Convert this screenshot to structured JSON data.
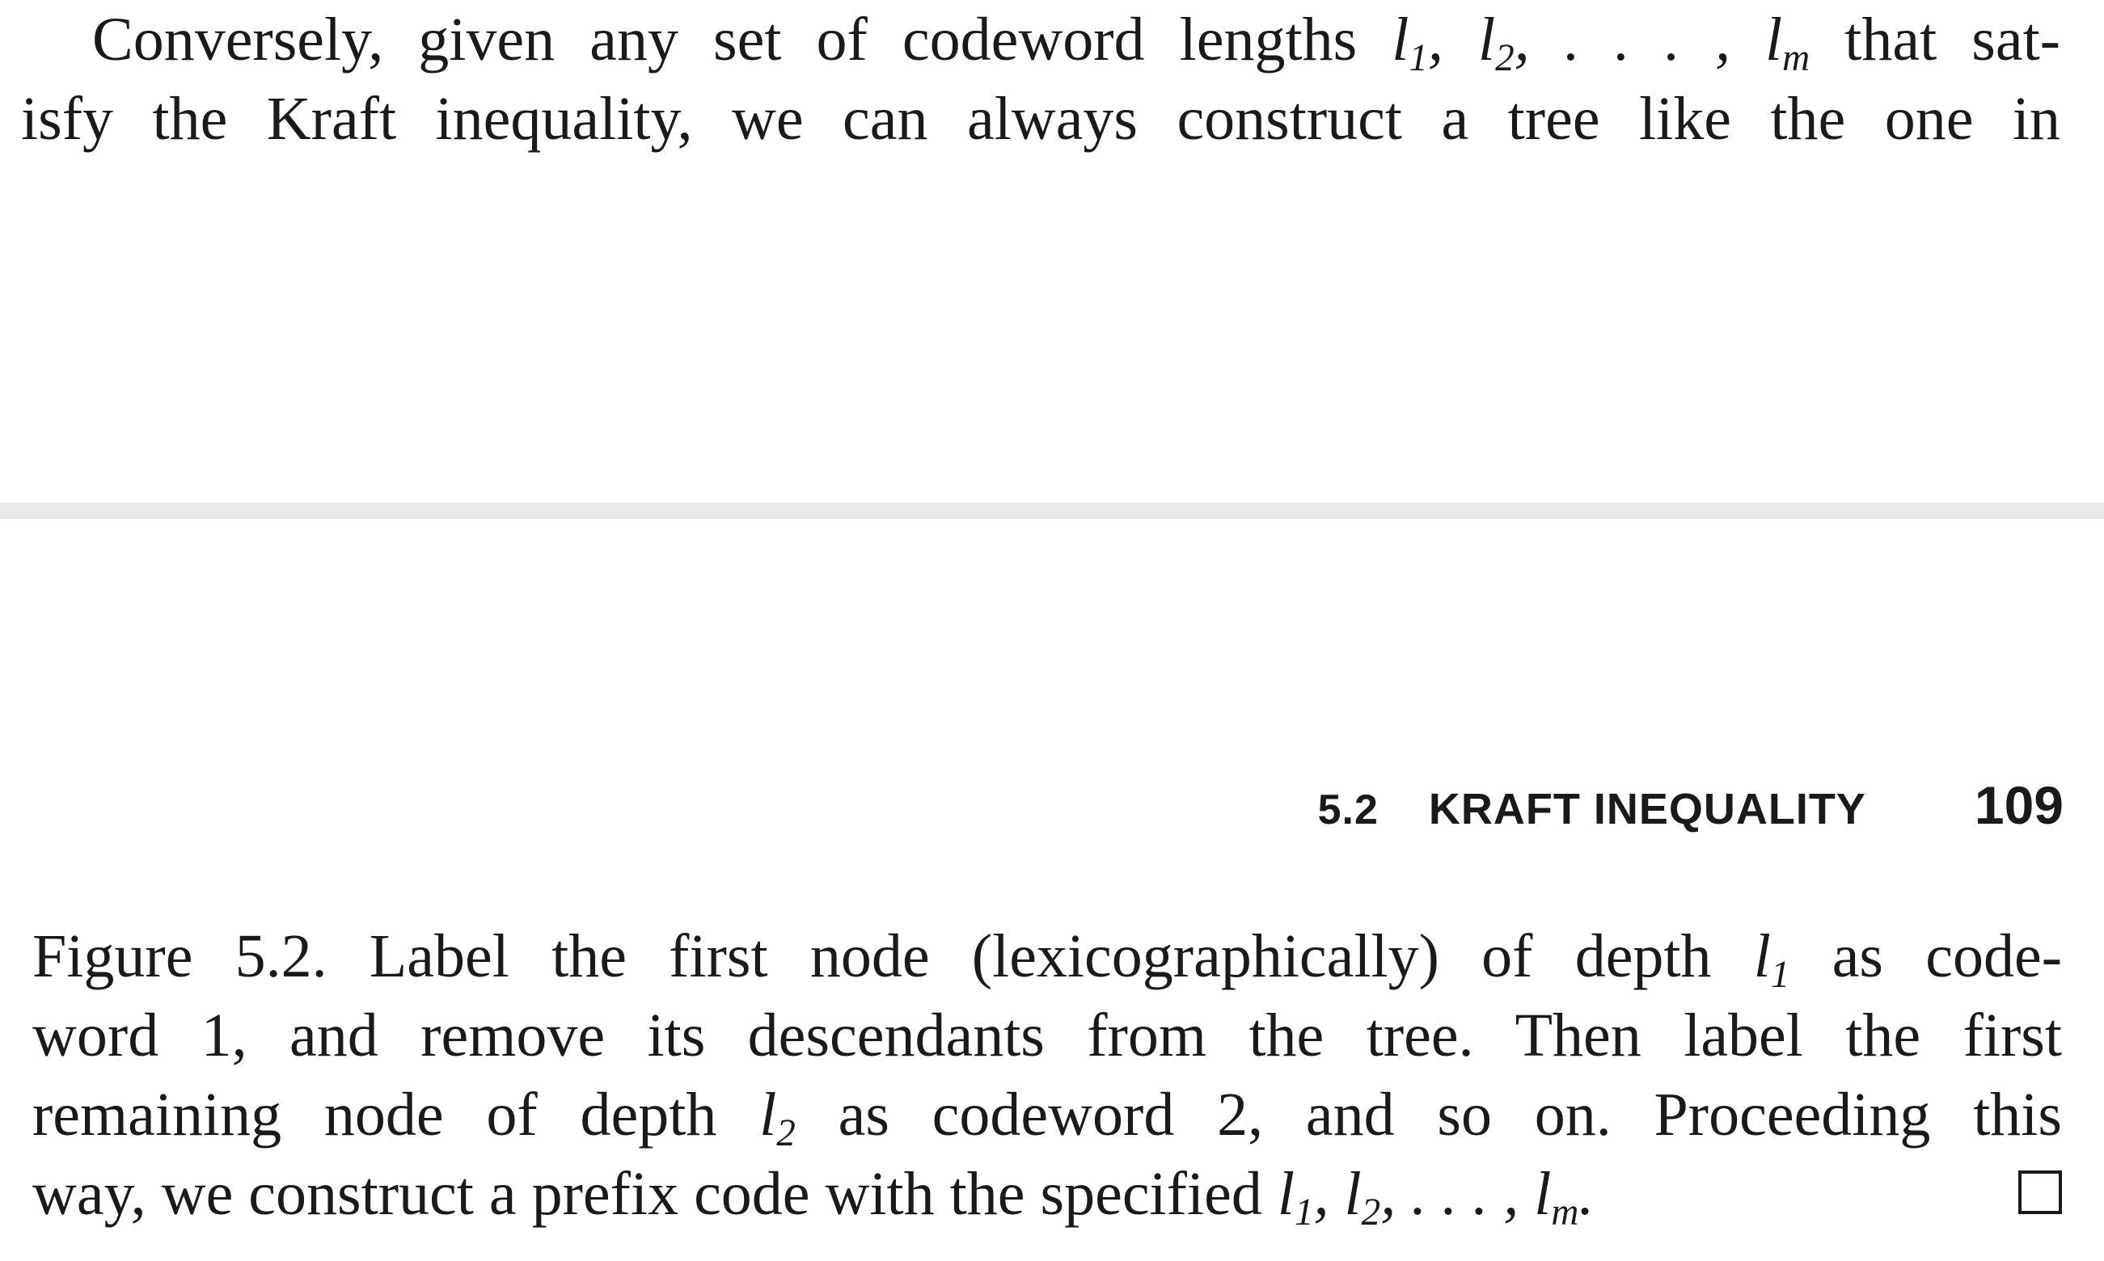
{
  "top_paragraph": {
    "line1": {
      "text_before": "Conversely, given any set of codeword lengths",
      "math": "l1, l2, . . . , lm",
      "text_after": "that sat-"
    },
    "line2": "isfy the Kraft inequality, we can always construct a tree like the one in"
  },
  "running_head": {
    "section_number": "5.2",
    "section_title": "KRAFT INEQUALITY",
    "page_number": "109"
  },
  "figure_caption": {
    "line1": {
      "text_before": "Figure 5.2. Label the first node (lexicographically) of depth",
      "math": "l1",
      "text_after": "as code-"
    },
    "line2": "word 1, and remove its descendants from the tree. Then label the first",
    "line3": {
      "text_before": "remaining node of depth",
      "math": "l2",
      "text_after": "as codeword 2, and so on. Proceeding this"
    },
    "line4": {
      "text_before": "way, we construct a prefix code with the specified",
      "math": "l1, l2, . . . , lm."
    }
  },
  "end_of_proof_symbol": "square"
}
